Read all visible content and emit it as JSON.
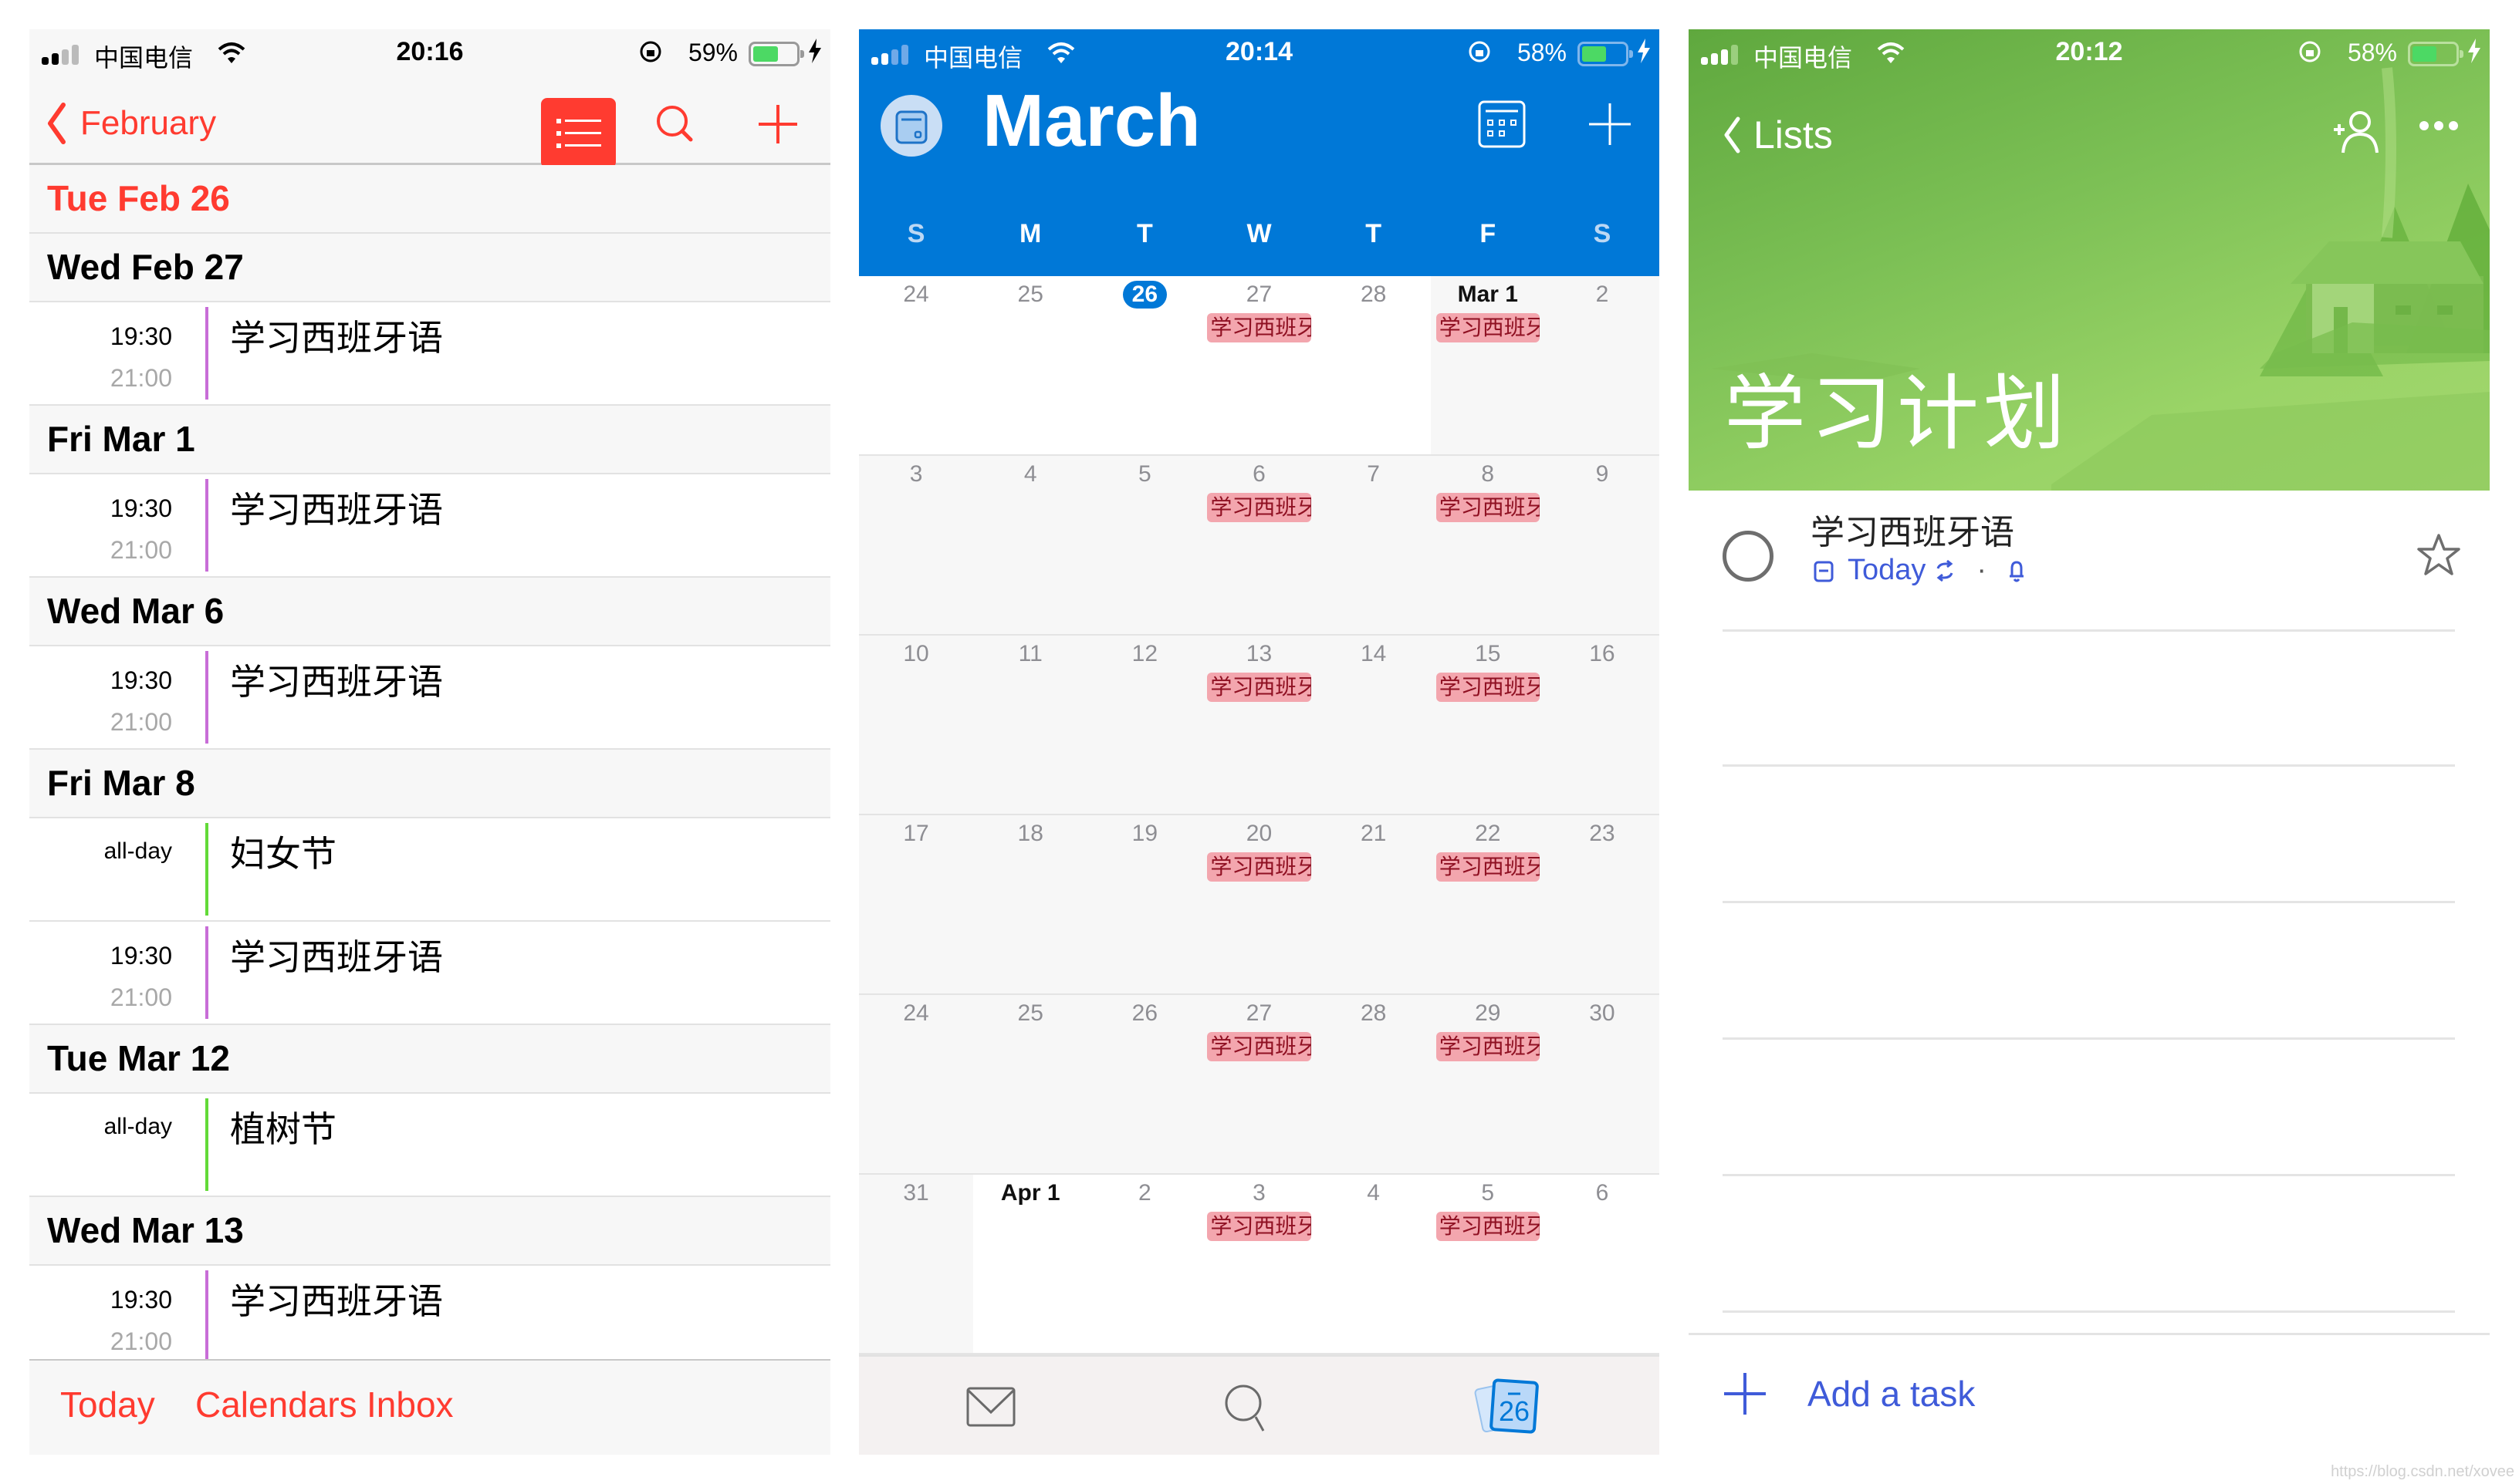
{
  "screens": {
    "ios_calendar": {
      "status": {
        "carrier": "中国电信",
        "time": "20:16",
        "battery": "59%",
        "battery_level": 0.59
      },
      "nav": {
        "back_label": "February"
      },
      "days": [
        {
          "label": "Tue  Feb 26",
          "is_today": true,
          "events": []
        },
        {
          "label": "Wed  Feb 27",
          "events": [
            {
              "start": "19:30",
              "end": "21:00",
              "title": "学习西班牙语",
              "color": "#c86dd7"
            }
          ]
        },
        {
          "label": "Fri  Mar 1",
          "events": [
            {
              "start": "19:30",
              "end": "21:00",
              "title": "学习西班牙语",
              "color": "#c86dd7"
            }
          ]
        },
        {
          "label": "Wed  Mar 6",
          "events": [
            {
              "start": "19:30",
              "end": "21:00",
              "title": "学习西班牙语",
              "color": "#c86dd7"
            }
          ]
        },
        {
          "label": "Fri  Mar 8",
          "events": [
            {
              "start": "all-day",
              "end": "",
              "title": "妇女节",
              "color": "#63da38"
            },
            {
              "start": "19:30",
              "end": "21:00",
              "title": "学习西班牙语",
              "color": "#c86dd7"
            }
          ]
        },
        {
          "label": "Tue  Mar 12",
          "events": [
            {
              "start": "all-day",
              "end": "",
              "title": "植树节",
              "color": "#63da38"
            }
          ]
        },
        {
          "label": "Wed  Mar 13",
          "events": [
            {
              "start": "19:30",
              "end": "21:00",
              "title": "学习西班牙语",
              "color": "#c86dd7"
            }
          ]
        }
      ],
      "tabs": {
        "today": "Today",
        "calendars": "Calendars",
        "inbox": "Inbox"
      },
      "accent": "#ff3b30"
    },
    "outlook_calendar": {
      "status": {
        "carrier": "中国电信",
        "time": "20:14",
        "battery": "58%",
        "battery_level": 0.58
      },
      "month_title": "March",
      "weekdays": [
        "S",
        "M",
        "T",
        "W",
        "T",
        "F",
        "S"
      ],
      "weeks": [
        [
          {
            "d": "24",
            "m": "other"
          },
          {
            "d": "25",
            "m": "other"
          },
          {
            "d": "26",
            "m": "other",
            "today": true
          },
          {
            "d": "27",
            "m": "other",
            "event": "学习西班牙语"
          },
          {
            "d": "28",
            "m": "other"
          },
          {
            "d": "Mar 1",
            "m": "cur",
            "bold": true,
            "event": "学习西班牙语"
          },
          {
            "d": "2",
            "m": "cur"
          }
        ],
        [
          {
            "d": "3",
            "m": "cur"
          },
          {
            "d": "4",
            "m": "cur"
          },
          {
            "d": "5",
            "m": "cur"
          },
          {
            "d": "6",
            "m": "cur",
            "event": "学习西班牙语"
          },
          {
            "d": "7",
            "m": "cur"
          },
          {
            "d": "8",
            "m": "cur",
            "event": "学习西班牙语"
          },
          {
            "d": "9",
            "m": "cur"
          }
        ],
        [
          {
            "d": "10",
            "m": "cur"
          },
          {
            "d": "11",
            "m": "cur"
          },
          {
            "d": "12",
            "m": "cur"
          },
          {
            "d": "13",
            "m": "cur",
            "event": "学习西班牙语"
          },
          {
            "d": "14",
            "m": "cur"
          },
          {
            "d": "15",
            "m": "cur",
            "event": "学习西班牙语"
          },
          {
            "d": "16",
            "m": "cur"
          }
        ],
        [
          {
            "d": "17",
            "m": "cur"
          },
          {
            "d": "18",
            "m": "cur"
          },
          {
            "d": "19",
            "m": "cur"
          },
          {
            "d": "20",
            "m": "cur",
            "event": "学习西班牙语"
          },
          {
            "d": "21",
            "m": "cur"
          },
          {
            "d": "22",
            "m": "cur",
            "event": "学习西班牙语"
          },
          {
            "d": "23",
            "m": "cur"
          }
        ],
        [
          {
            "d": "24",
            "m": "cur"
          },
          {
            "d": "25",
            "m": "cur"
          },
          {
            "d": "26",
            "m": "cur"
          },
          {
            "d": "27",
            "m": "cur",
            "event": "学习西班牙语"
          },
          {
            "d": "28",
            "m": "cur"
          },
          {
            "d": "29",
            "m": "cur",
            "event": "学习西班牙语"
          },
          {
            "d": "30",
            "m": "cur"
          }
        ],
        [
          {
            "d": "31",
            "m": "cur"
          },
          {
            "d": "Apr 1",
            "m": "other",
            "bold": true
          },
          {
            "d": "2",
            "m": "other"
          },
          {
            "d": "3",
            "m": "other",
            "event": "学习西班牙语"
          },
          {
            "d": "4",
            "m": "other"
          },
          {
            "d": "5",
            "m": "other",
            "event": "学习西班牙语"
          },
          {
            "d": "6",
            "m": "other"
          }
        ]
      ],
      "tab_calendar_badge": "26",
      "accent": "#0078d7"
    },
    "todo": {
      "status": {
        "carrier": "中国电信",
        "time": "20:12",
        "battery": "58%",
        "battery_level": 0.58
      },
      "back_label": "Lists",
      "list_title": "学习计划",
      "tasks": [
        {
          "title": "学习西班牙语",
          "due": "Today",
          "starred": false
        }
      ],
      "add_task_label": "Add a task",
      "accent": "#3f5bd9"
    }
  },
  "watermark": "https://blog.csdn.net/xovee"
}
